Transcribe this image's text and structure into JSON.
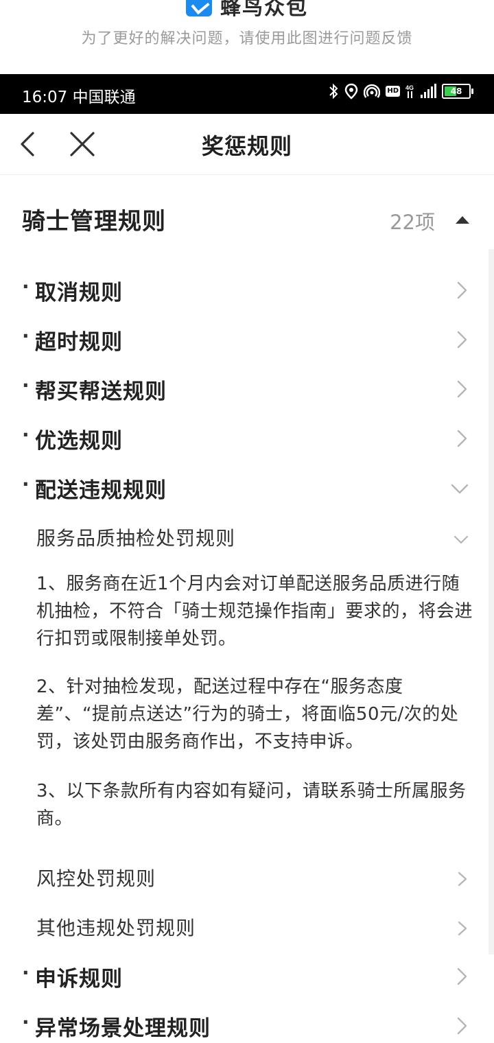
{
  "banner": {
    "app_name": "蜂鸟众包",
    "subtitle": "为了更好的解决问题，请使用此图进行问题反馈"
  },
  "status_bar": {
    "time": "16:07",
    "carrier": "中国联通",
    "battery": "48",
    "icons": [
      "bluetooth-icon",
      "location-icon",
      "hotspot-icon",
      "hd-icon",
      "4g-icon",
      "signal-icon",
      "battery-icon"
    ]
  },
  "nav": {
    "title": "奖惩规则",
    "back_icon": "back-arrow-icon",
    "close_icon": "close-icon"
  },
  "section": {
    "title": "骑士管理规则",
    "count": "22项",
    "expanded": true
  },
  "rules": [
    {
      "label": "取消规则",
      "state": "collapsed"
    },
    {
      "label": "超时规则",
      "state": "collapsed"
    },
    {
      "label": "帮买帮送规则",
      "state": "collapsed"
    },
    {
      "label": "优选规则",
      "state": "collapsed"
    },
    {
      "label": "配送违规规则",
      "state": "expanded"
    }
  ],
  "sub_rules": {
    "expanded_title": "服务品质抽检处罚规则",
    "paragraphs": [
      "1、服务商在近1个月内会对订单配送服务品质进行随机抽检，不符合「骑士规范操作指南」要求的，将会进行扣罚或限制接单处罚。",
      "2、针对抽检发现，配送过程中存在“服务态度差”、“提前点送达”行为的骑士，将面临50元/次的处罚，该处罚由服务商作出，不支持申诉。",
      "3、以下条款所有内容如有疑问，请联系骑士所属服务商。"
    ],
    "others": [
      "风控处罚规则",
      "其他违规处罚规则"
    ]
  },
  "rules_after": [
    {
      "label": "申诉规则",
      "state": "collapsed"
    },
    {
      "label": "异常场景处理规则",
      "state": "collapsed"
    }
  ],
  "colors": {
    "status_bar_bg": "#000000",
    "battery_fill": "#3ccf4e",
    "text_primary": "#222222",
    "text_secondary": "#999999",
    "chevron": "#b5b5b5"
  }
}
